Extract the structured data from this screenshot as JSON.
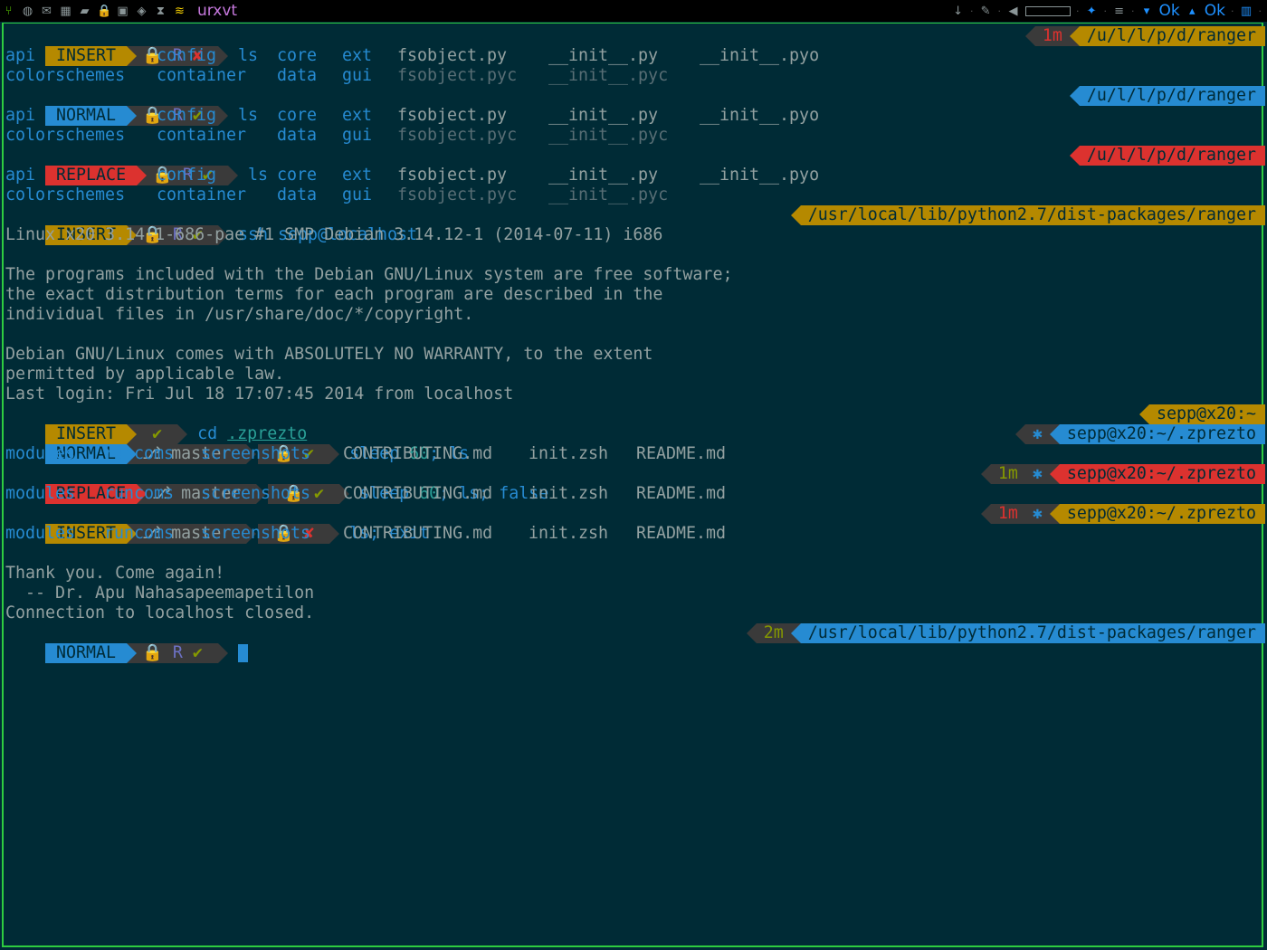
{
  "topbar": {
    "title": "urxvt",
    "ok1": "Ok",
    "ok2": "Ok",
    "sep": "·"
  },
  "prompts": {
    "insert": "INSERT",
    "normal": "NORMAL",
    "replace": "REPLACE",
    "r": "R",
    "branch": "master",
    "lock": "🔒",
    "check": "✔",
    "cross": "✘",
    "star": "✱"
  },
  "lines": {
    "l1_cmd": "ls",
    "l1_dur": "1m",
    "path_short": "/u/l/l/p/d/ranger",
    "ls_row1": [
      "api",
      "config",
      "core",
      "ext",
      "fsobject.py",
      "__init__.py",
      "__init__.pyo"
    ],
    "ls_row2": [
      "colorschemes",
      "container",
      "data",
      "gui",
      "fsobject.pyc",
      "__init__.pyc"
    ],
    "l4_cmd": "ssh sepp@localhost",
    "path_long": "/usr/local/lib/python2.7/dist-packages/ranger",
    "motd": [
      "Linux x20 3.14-1-686-pae #1 SMP Debian 3.14.12-1 (2014-07-11) i686",
      "",
      "The programs included with the Debian GNU/Linux system are free software;",
      "the exact distribution terms for each program are described in the",
      "individual files in /usr/share/doc/*/copyright.",
      "",
      "Debian GNU/Linux comes with ABSOLUTELY NO WARRANTY, to the extent",
      "permitted by applicable law.",
      "Last login: Fri Jul 18 17:07:45 2014 from localhost"
    ],
    "cd_cmd": "cd",
    "cd_arg": ".zprezto",
    "home_path": "sepp@x20:~",
    "zprezto_path": "sepp@x20:~/.zprezto",
    "sleep_cmd1": "sleep",
    "sleep_num": "60",
    "sleep_rest1": "; ls",
    "sleep_rest2_a": "; ls; ",
    "sleep_rest2_b": "false",
    "dur_1m": "1m",
    "ls_exit_a": "ls",
    "ls_exit_b": "; exit",
    "zp_row": [
      "modules",
      "runcoms",
      "screenshots",
      "CONTRIBUTING.md",
      "init.zsh",
      "README.md"
    ],
    "outro": [
      "Thank you. Come again!",
      "  -- Dr. Apu Nahasapeemapetilon",
      "Connection to localhost closed."
    ],
    "final_dur": "2m"
  }
}
